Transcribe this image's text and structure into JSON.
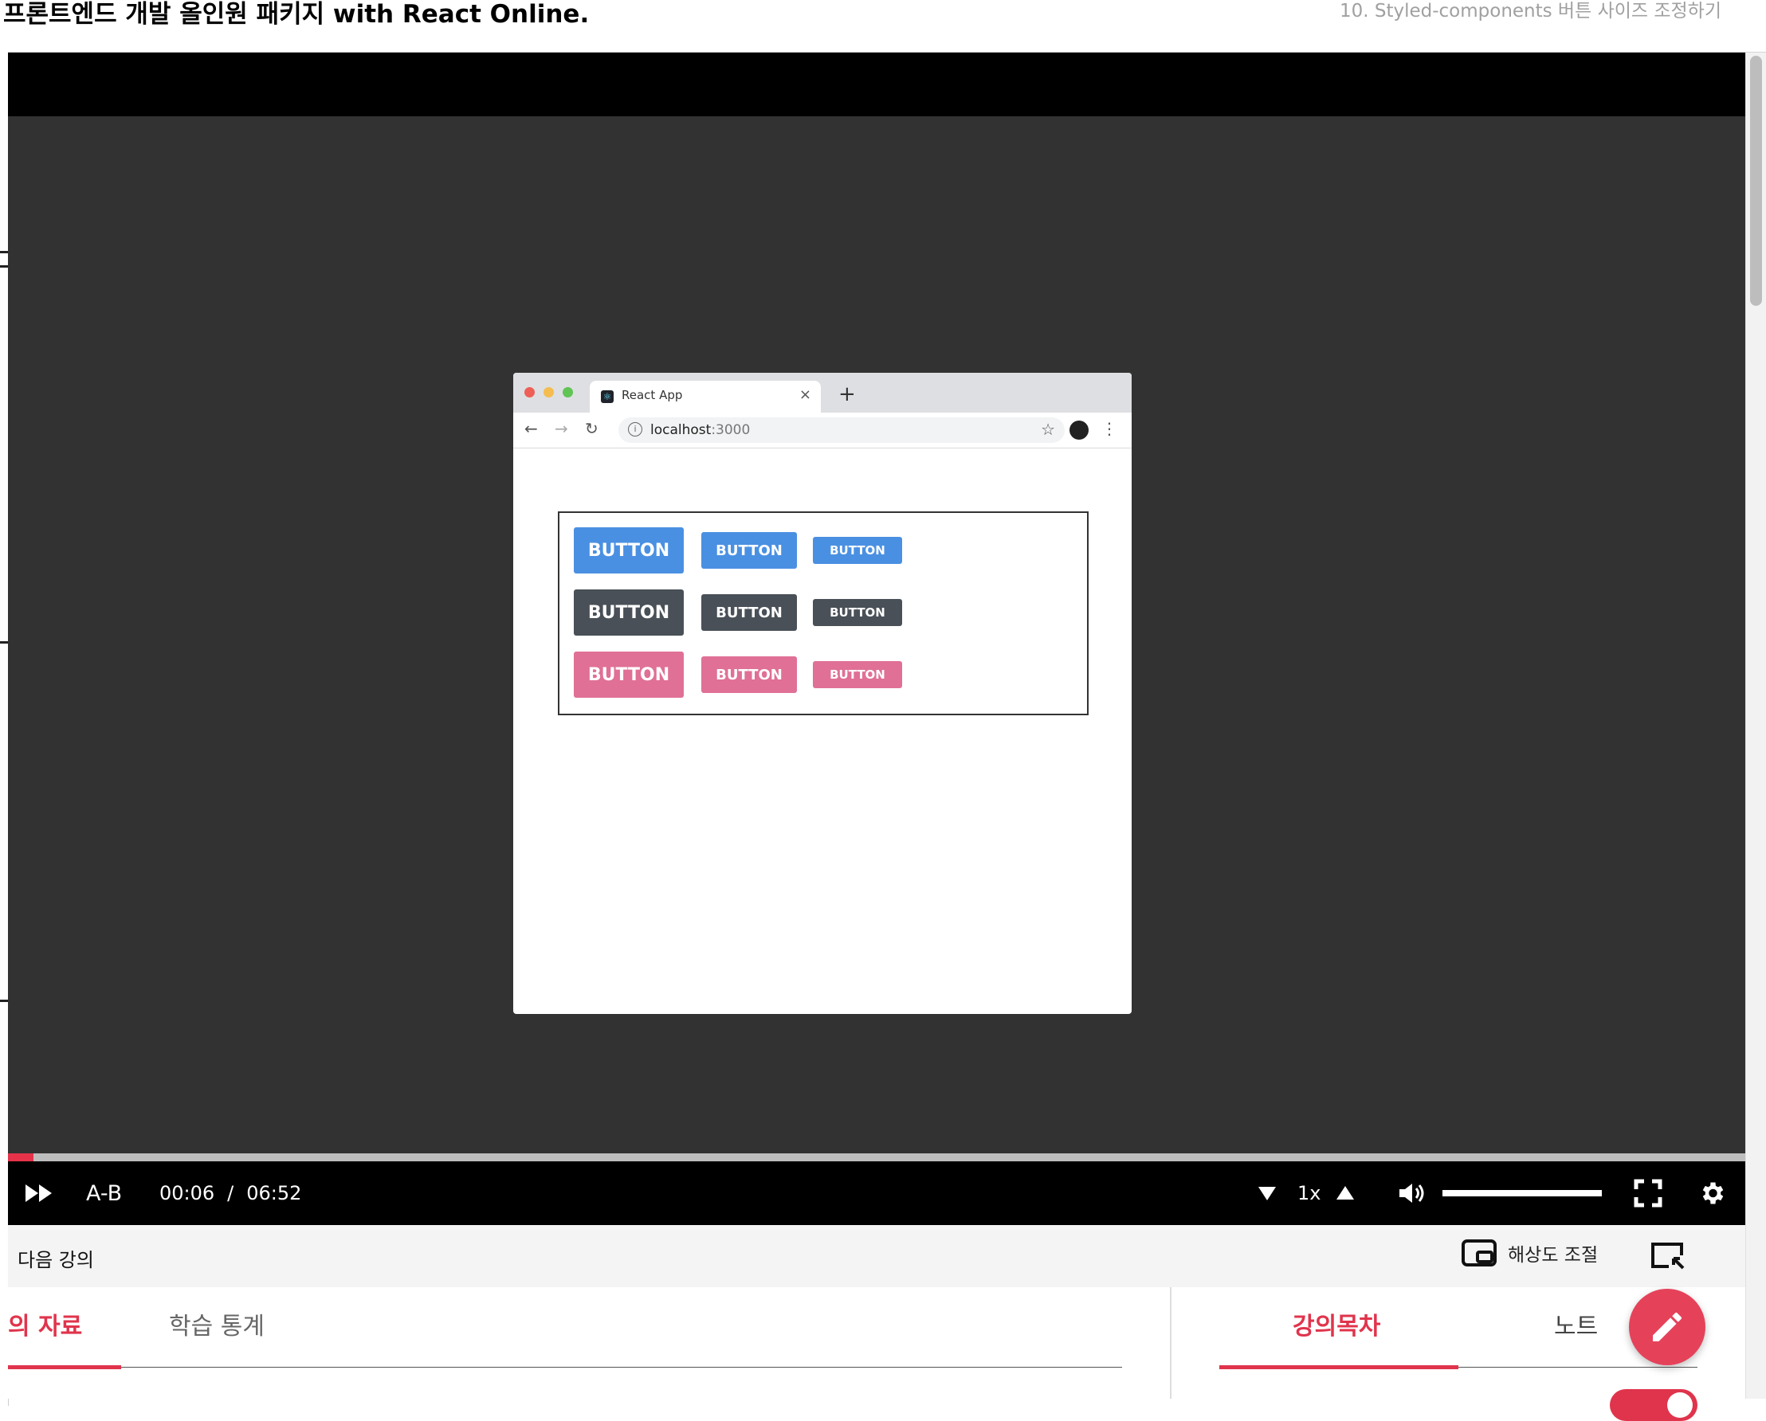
{
  "header": {
    "course_title": "프론트엔드 개발 올인원 패키지 with React Online.",
    "lecture_title": "10. Styled-components 버튼 사이즈 조정하기"
  },
  "player": {
    "progress_fraction": 0.0146,
    "ab_label": "A-B",
    "current_time": "00:06",
    "time_separator": "/",
    "duration": "06:52",
    "speed": "1x",
    "volume_fraction": 1.0,
    "colors": {
      "progress": "#e6334a",
      "bar": "#000000",
      "background": "#323232"
    }
  },
  "recording": {
    "browser": {
      "tab_title": "React App",
      "url_host": "localhost",
      "url_port": ":3000",
      "traffic_lights": [
        "#ee5f57",
        "#f5bd4f",
        "#5fc454"
      ]
    },
    "button_rows": [
      {
        "color": "#4a90e2",
        "labels": [
          "BUTTON",
          "BUTTON",
          "BUTTON"
        ]
      },
      {
        "color": "#495057",
        "labels": [
          "BUTTON",
          "BUTTON",
          "BUTTON"
        ]
      },
      {
        "color": "#e07095",
        "labels": [
          "BUTTON",
          "BUTTON",
          "BUTTON"
        ]
      }
    ]
  },
  "subbar": {
    "next_lecture": "다음 강의",
    "resolution_label": "해상도 조절"
  },
  "tabs": {
    "left": [
      {
        "label": "의 자료",
        "active": true
      },
      {
        "label": "학습 통계",
        "active": false
      }
    ],
    "right": [
      {
        "label": "강의목차",
        "active": true
      },
      {
        "label": "노트",
        "active": false
      }
    ],
    "accent": "#e0344c"
  },
  "icons": [
    "fast-forward-icon",
    "speed-down-icon",
    "speed-up-icon",
    "volume-icon",
    "fullscreen-icon",
    "settings-icon",
    "resolution-icon",
    "pip-icon",
    "pencil-icon",
    "react-favicon",
    "back-arrow-icon",
    "forward-arrow-icon",
    "reload-icon",
    "info-icon",
    "star-icon",
    "profile-icon",
    "kebab-menu-icon",
    "close-icon",
    "new-tab-icon"
  ]
}
